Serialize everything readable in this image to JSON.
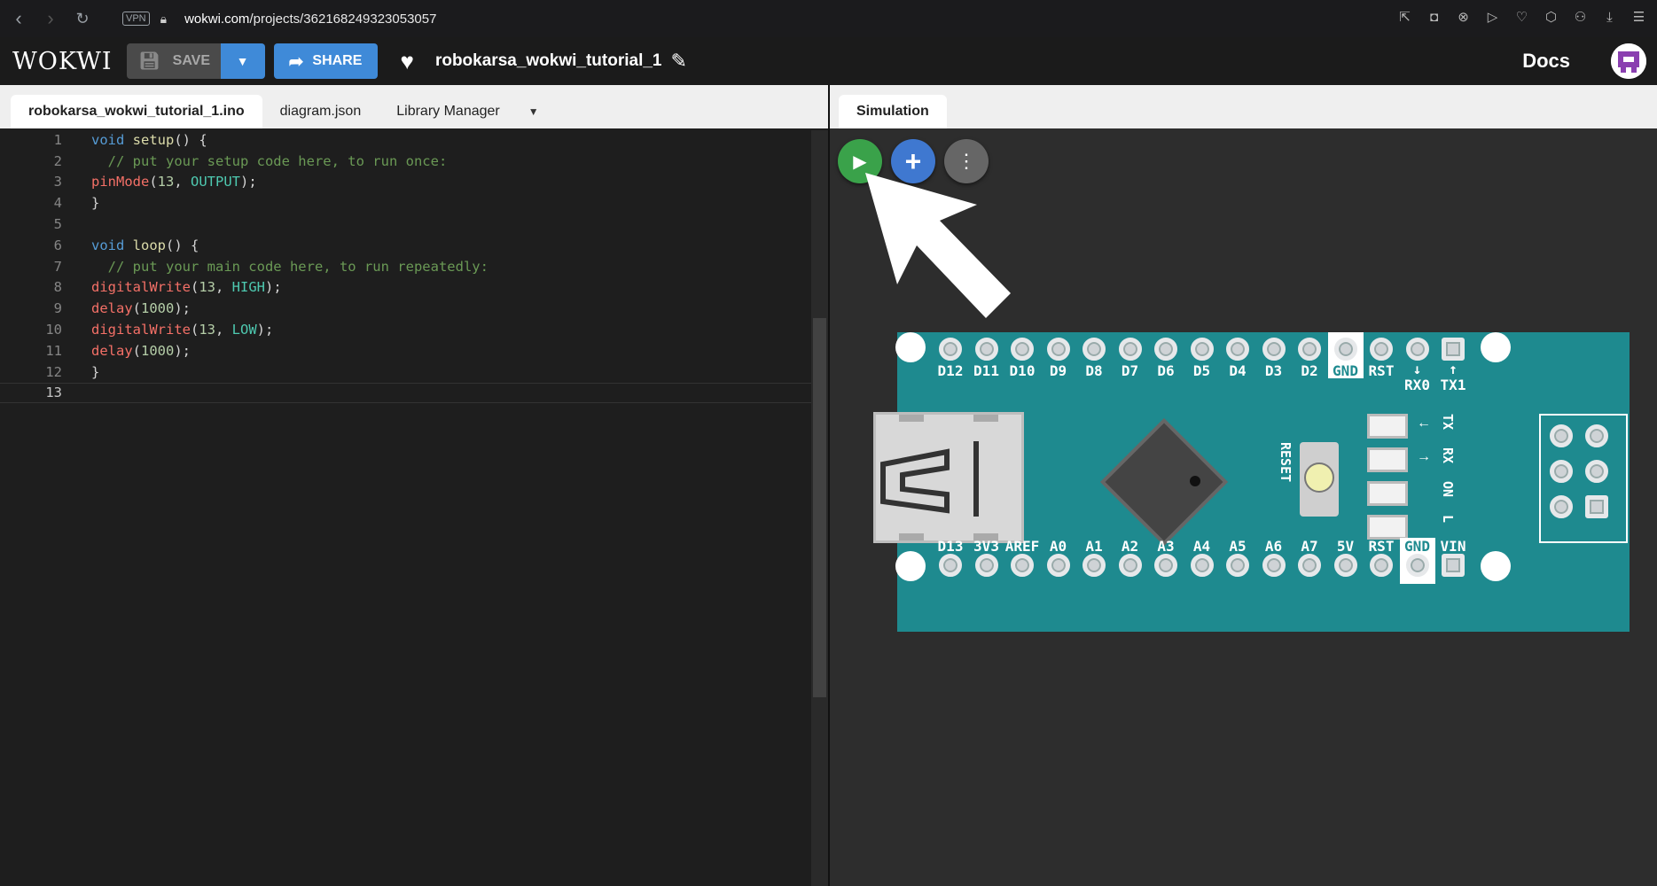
{
  "browser": {
    "vpn": "VPN",
    "url_host": "wokwi.com",
    "url_path": "/projects/362168249323053057"
  },
  "header": {
    "logo": "WOKWI",
    "save_label": "SAVE",
    "share_label": "SHARE",
    "project_title": "robokarsa_wokwi_tutorial_1",
    "docs_label": "Docs"
  },
  "editor": {
    "tabs": [
      "robokarsa_wokwi_tutorial_1.ino",
      "diagram.json",
      "Library Manager"
    ],
    "active_tab": 0,
    "current_line": 13,
    "lines": [
      [
        [
          "kw",
          "void"
        ],
        [
          "t",
          " "
        ],
        [
          "fnname",
          "setup"
        ],
        [
          "t",
          "() {"
        ]
      ],
      [
        [
          "t",
          "  "
        ],
        [
          "cmt",
          "// put your setup code here, to run once:"
        ]
      ],
      [
        [
          "fn",
          "pinMode"
        ],
        [
          "t",
          "("
        ],
        [
          "num",
          "13"
        ],
        [
          "t",
          ", "
        ],
        [
          "cst",
          "OUTPUT"
        ],
        [
          "t",
          ");"
        ]
      ],
      [
        [
          "t",
          "}"
        ]
      ],
      [],
      [
        [
          "kw",
          "void"
        ],
        [
          "t",
          " "
        ],
        [
          "fnname",
          "loop"
        ],
        [
          "t",
          "() {"
        ]
      ],
      [
        [
          "t",
          "  "
        ],
        [
          "cmt",
          "// put your main code here, to run repeatedly:"
        ]
      ],
      [
        [
          "fn",
          "digitalWrite"
        ],
        [
          "t",
          "("
        ],
        [
          "num",
          "13"
        ],
        [
          "t",
          ", "
        ],
        [
          "cst",
          "HIGH"
        ],
        [
          "t",
          ");"
        ]
      ],
      [
        [
          "fn",
          "delay"
        ],
        [
          "t",
          "("
        ],
        [
          "num",
          "1000"
        ],
        [
          "t",
          ");"
        ]
      ],
      [
        [
          "fn",
          "digitalWrite"
        ],
        [
          "t",
          "("
        ],
        [
          "num",
          "13"
        ],
        [
          "t",
          ", "
        ],
        [
          "cst",
          "LOW"
        ],
        [
          "t",
          ");"
        ]
      ],
      [
        [
          "fn",
          "delay"
        ],
        [
          "t",
          "("
        ],
        [
          "num",
          "1000"
        ],
        [
          "t",
          ");"
        ]
      ],
      [
        [
          "t",
          "}"
        ]
      ],
      []
    ]
  },
  "simulation": {
    "tab_label": "Simulation",
    "board": {
      "top_pins": [
        "D12",
        "D11",
        "D10",
        "D9",
        "D8",
        "D7",
        "D6",
        "D5",
        "D4",
        "D3",
        "D2",
        "GND",
        "RST",
        "RX0",
        "TX1"
      ],
      "top_arrows": [
        "↓",
        "↑"
      ],
      "bottom_pins": [
        "D13",
        "3V3",
        "AREF",
        "A0",
        "A1",
        "A2",
        "A3",
        "A4",
        "A5",
        "A6",
        "A7",
        "5V",
        "RST",
        "GND",
        "VIN"
      ],
      "reset_label": "RESET",
      "led_labels": [
        "TX",
        "RX",
        "ON",
        "L"
      ],
      "led_arrows": [
        "←",
        "→"
      ]
    }
  }
}
